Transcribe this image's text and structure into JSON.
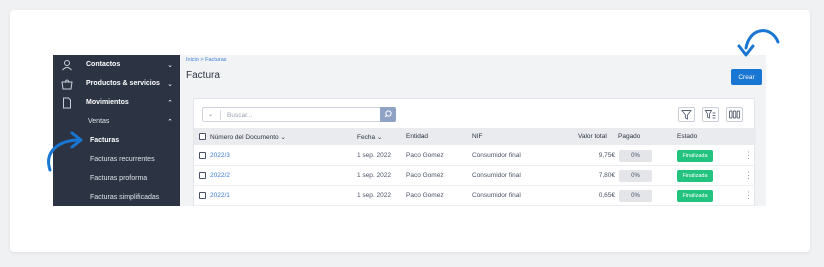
{
  "colors": {
    "sidebar_bg": "#2c3443",
    "primary": "#1976d2",
    "link": "#3a7bd5",
    "success": "#22c27f"
  },
  "sidebar": {
    "items": [
      {
        "label": "Contactos",
        "icon": "person-icon",
        "chevron": "⌄"
      },
      {
        "label": "Productos & servicios",
        "icon": "basket-icon",
        "chevron": "⌄"
      },
      {
        "label": "Movimientos",
        "icon": "document-icon",
        "chevron": "⌃"
      }
    ],
    "ventas": {
      "label": "Ventas",
      "chevron": "⌃"
    },
    "subitems": [
      {
        "label": "Facturas"
      },
      {
        "label": "Facturas recurrentes"
      },
      {
        "label": "Facturas proforma"
      },
      {
        "label": "Facturas simplificadas"
      }
    ]
  },
  "header": {
    "breadcrumb": "Inicio > Facturas",
    "title": "Factura",
    "crear_label": "Crear"
  },
  "search": {
    "placeholder": "Buscar..."
  },
  "table": {
    "columns": [
      "Número del Documento",
      "Fecha",
      "Entidad",
      "NIF",
      "Valor total",
      "Pagado",
      "Estado"
    ],
    "sort_indicator": "⌄",
    "rows": [
      {
        "doc": "2022/3",
        "fecha": "1 sep. 2022",
        "entidad": "Paco Gomez",
        "nif": "Consumidor final",
        "valor": "9,75€",
        "pagado": "0%",
        "estado": "Finalizada"
      },
      {
        "doc": "2022/2",
        "fecha": "1 sep. 2022",
        "entidad": "Paco Gomez",
        "nif": "Consumidor final",
        "valor": "7,80€",
        "pagado": "0%",
        "estado": "Finalizada"
      },
      {
        "doc": "2022/1",
        "fecha": "1 sep. 2022",
        "entidad": "Paco Gomez",
        "nif": "Consumidor final",
        "valor": "0,65€",
        "pagado": "0%",
        "estado": "Finalizada"
      }
    ]
  },
  "annotations": {
    "arrow_color": "#1976d2"
  }
}
